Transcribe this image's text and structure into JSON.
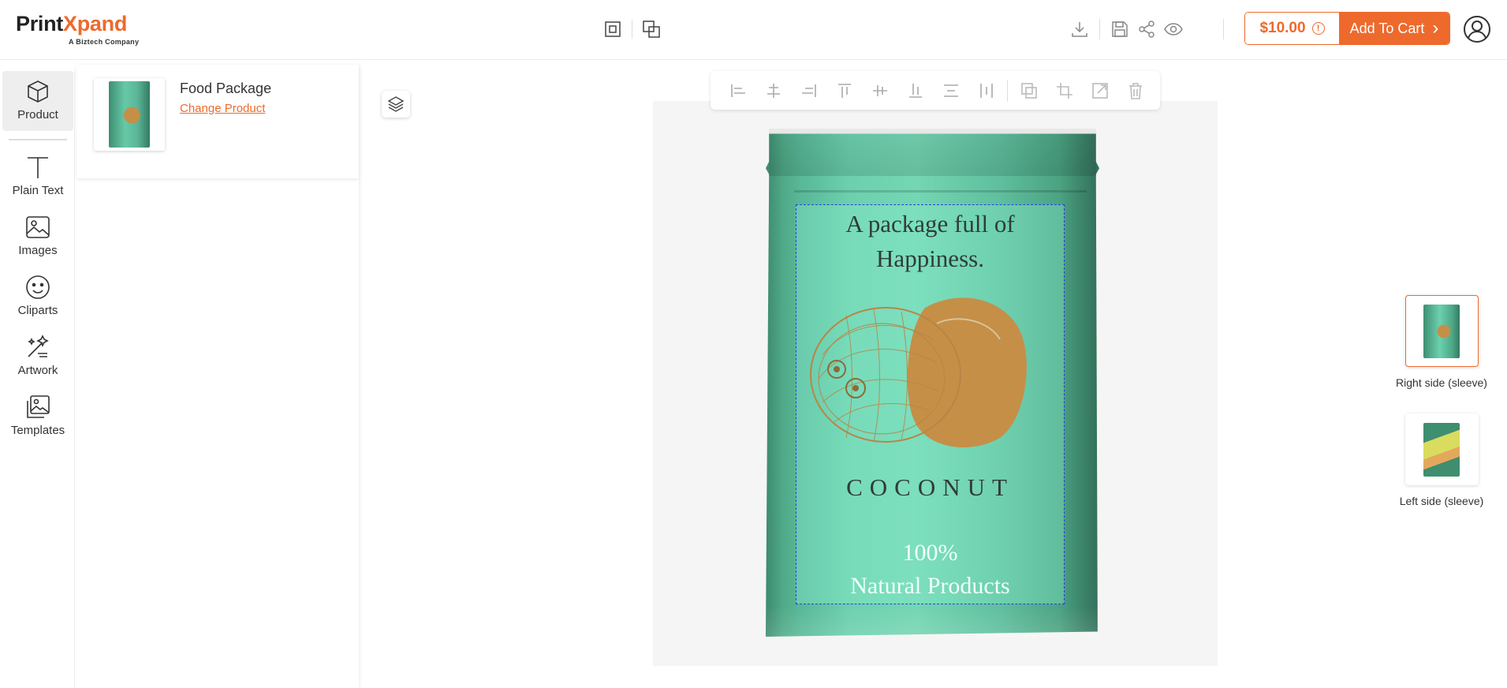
{
  "brand": {
    "name_part1": "Print",
    "name_part2": "X",
    "name_part3": "pand",
    "tagline": "A Biztech Company",
    "accent_color": "#ee6a2c"
  },
  "header": {
    "view_toggles": [
      "single-view-icon",
      "multi-view-icon"
    ],
    "tools": [
      "download-icon",
      "save-icon",
      "share-icon",
      "preview-icon"
    ],
    "price": "$10.00",
    "price_info_glyph": "!",
    "add_to_cart": "Add To Cart",
    "cart_arrow": "›"
  },
  "rail": {
    "items": [
      {
        "label": "Product",
        "icon": "cube-icon",
        "active": true
      },
      {
        "label": "Plain Text",
        "icon": "text-icon",
        "active": false
      },
      {
        "label": "Images",
        "icon": "image-icon",
        "active": false
      },
      {
        "label": "Cliparts",
        "icon": "smiley-icon",
        "active": false
      },
      {
        "label": "Artwork",
        "icon": "magic-wand-icon",
        "active": false
      },
      {
        "label": "Templates",
        "icon": "templates-icon",
        "active": false
      }
    ]
  },
  "product": {
    "title": "Food Package",
    "change_link": "Change Product"
  },
  "toolbar": {
    "tools": [
      "align-left-icon",
      "align-center-icon",
      "align-right-icon",
      "align-top-icon",
      "align-middle-icon",
      "align-bottom-icon",
      "distribute-vertical-icon",
      "distribute-horizontal-icon",
      "duplicate-icon",
      "crop-icon",
      "resize-icon",
      "delete-icon"
    ]
  },
  "design": {
    "headline": "A package full of Happiness.",
    "product_name": "COCONUT",
    "tagline_line1": "100%",
    "tagline_line2": "Natural Products",
    "bag_color": "#5fbf9e",
    "art_color": "#c58f47"
  },
  "sides": [
    {
      "label": "Right side (sleeve)",
      "active": true
    },
    {
      "label": "Left side (sleeve)",
      "active": false
    }
  ]
}
